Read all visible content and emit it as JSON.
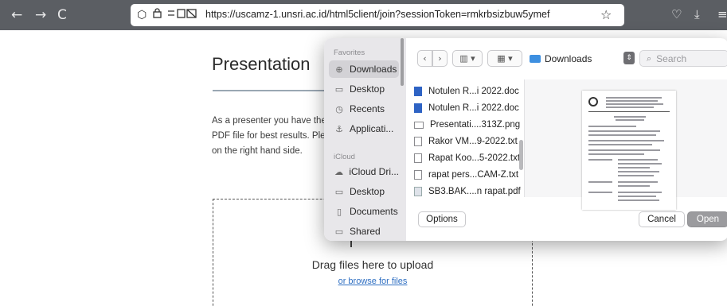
{
  "browser": {
    "url": "https://uscamz-1.unsri.ac.id/html5client/join?sessionToken=rmkrbsizbuw5ymef",
    "back_icon": "←",
    "forward_icon": "→",
    "reload_icon": "C",
    "shield_icon": "⬡",
    "lock_icon": "🔒",
    "star_icon": "☆",
    "pocket_icon": "♡",
    "download_icon": "⤓",
    "menu_icon": "≡"
  },
  "page": {
    "title": "Presentation",
    "description": "As a presenter you have the abilit PDF file for best results. Please en on the right hand side.",
    "drop_text": "Drag files here to upload",
    "browse_link": "or browse for files"
  },
  "dialog": {
    "sidebar": {
      "favorites_label": "Favorites",
      "favorites": [
        {
          "label": "Downloads",
          "icon": "download-circle-icon",
          "glyph": "⊕",
          "active": true
        },
        {
          "label": "Desktop",
          "icon": "desktop-icon",
          "glyph": "▭",
          "active": false
        },
        {
          "label": "Recents",
          "icon": "clock-icon",
          "glyph": "◷",
          "active": false
        },
        {
          "label": "Applicati...",
          "icon": "applications-icon",
          "glyph": "⚓",
          "active": false
        }
      ],
      "icloud_label": "iCloud",
      "icloud": [
        {
          "label": "iCloud Dri...",
          "icon": "cloud-icon",
          "glyph": "☁"
        },
        {
          "label": "Desktop",
          "icon": "desktop-icon",
          "glyph": "▭"
        },
        {
          "label": "Documents",
          "icon": "document-icon",
          "glyph": "▯"
        },
        {
          "label": "Shared",
          "icon": "shared-folder-icon",
          "glyph": "▭"
        }
      ]
    },
    "toolbar": {
      "back": "‹",
      "forward": "›",
      "view_columns": "▥ ▾",
      "view_grid": "▦ ▾",
      "location": "Downloads",
      "search_placeholder": "Search"
    },
    "files": [
      {
        "name": "Notulen R...i 2022.doc",
        "type": "doc"
      },
      {
        "name": "Notulen R...i 2022.doc",
        "type": "doc"
      },
      {
        "name": "Presentati....313Z.png",
        "type": "png"
      },
      {
        "name": "Rakor VM...9-2022.txt",
        "type": "txt"
      },
      {
        "name": "Rapat Koo...5-2022.txt",
        "type": "txt"
      },
      {
        "name": "rapat pers...CAM-Z.txt",
        "type": "txt"
      },
      {
        "name": "SB3.BAK....n rapat.pdf",
        "type": "pdf"
      }
    ],
    "buttons": {
      "options": "Options",
      "cancel": "Cancel",
      "open": "Open"
    }
  }
}
